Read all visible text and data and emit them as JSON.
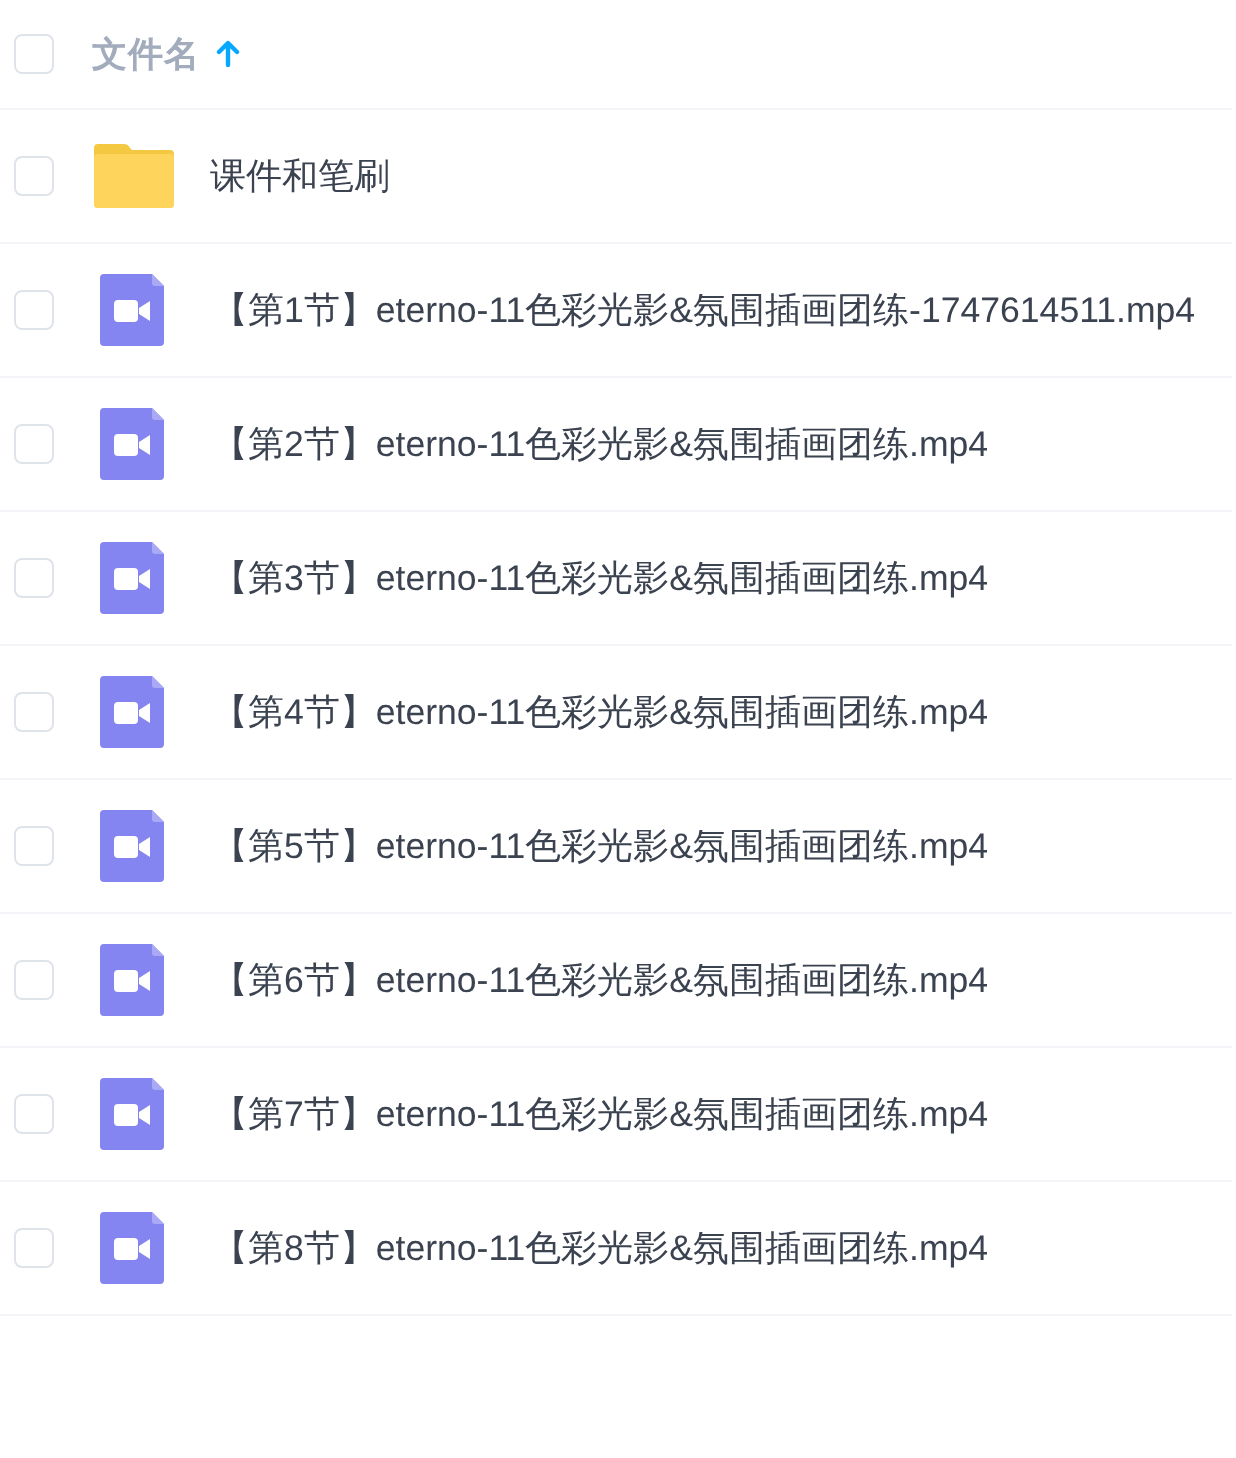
{
  "header": {
    "select_all": {
      "checked": false
    },
    "column": {
      "label": "文件名",
      "sort_ascending": true
    }
  },
  "files": [
    {
      "kind": "folder",
      "name": "课件和笔刷",
      "checked": false
    },
    {
      "kind": "video",
      "name": "【第1节】eterno-11色彩光影&氛围插画团练-1747614511.mp4",
      "checked": false
    },
    {
      "kind": "video",
      "name": "【第2节】eterno-11色彩光影&氛围插画团练.mp4",
      "checked": false
    },
    {
      "kind": "video",
      "name": "【第3节】eterno-11色彩光影&氛围插画团练.mp4",
      "checked": false
    },
    {
      "kind": "video",
      "name": "【第4节】eterno-11色彩光影&氛围插画团练.mp4",
      "checked": false
    },
    {
      "kind": "video",
      "name": "【第5节】eterno-11色彩光影&氛围插画团练.mp4",
      "checked": false
    },
    {
      "kind": "video",
      "name": "【第6节】eterno-11色彩光影&氛围插画团练.mp4",
      "checked": false
    },
    {
      "kind": "video",
      "name": "【第7节】eterno-11色彩光影&氛围插画团练.mp4",
      "checked": false
    },
    {
      "kind": "video",
      "name": "【第8节】eterno-11色彩光影&氛围插画团练.mp4",
      "checked": false
    }
  ]
}
